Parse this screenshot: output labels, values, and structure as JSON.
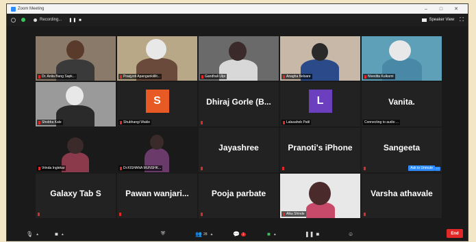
{
  "window": {
    "title": "Zoom Meeting"
  },
  "topbar": {
    "recording_label": "Recording...",
    "controls": "❚❚ ■",
    "speaker_view_label": "Speaker View"
  },
  "tiles": [
    {
      "name": "Dr. Anita Bang Sapk...",
      "type": "video",
      "muted": true
    },
    {
      "name": "Prasjyoti Apangankiillit...",
      "type": "video",
      "muted": true
    },
    {
      "name": "Gandhali Ulpi",
      "type": "video",
      "muted": true
    },
    {
      "name": "Anagha Belsare",
      "type": "video",
      "muted": true
    },
    {
      "name": "Nivedita Kulkarni",
      "type": "video",
      "muted": true,
      "active": true
    },
    {
      "name": "Shobha Kale",
      "type": "video",
      "muted": true
    },
    {
      "name": "Shubhangi Wakle",
      "type": "avatar",
      "initial": "S",
      "avatar_color": "#e85a24",
      "muted": true
    },
    {
      "name": "Dhiraj Gorle (B...",
      "type": "name",
      "muted": true
    },
    {
      "name": "Lalasaheb Patil",
      "type": "avatar",
      "initial": "L",
      "avatar_color": "#6b3fbd",
      "muted": true
    },
    {
      "name": "Vanita.",
      "type": "name",
      "status": "Connecting to audio ...",
      "muted": false
    },
    {
      "name": "Vrinda Inglekar",
      "type": "video",
      "muted": true
    },
    {
      "name": "Dr.KISHANA MUNSHK...",
      "type": "video",
      "muted": true
    },
    {
      "name": "Jayashree",
      "type": "name",
      "muted": true
    },
    {
      "name": "Pranoti's iPhone",
      "type": "name",
      "muted": true
    },
    {
      "name": "Sangeeta",
      "type": "name",
      "muted": true,
      "ask_to_unmute": "Ask to Unmute",
      "more": "···"
    },
    {
      "name": "Galaxy Tab S",
      "type": "name",
      "muted": true
    },
    {
      "name": "Pawan  wanjari...",
      "type": "name",
      "muted": true
    },
    {
      "name": "Pooja parbate",
      "type": "name",
      "muted": true
    },
    {
      "name": "Alka Shinde",
      "type": "video",
      "muted": true
    },
    {
      "name": "Varsha athavale",
      "type": "name",
      "muted": true
    }
  ],
  "toolbar": {
    "participants_count": "28",
    "chat_badge": "1",
    "end_label": "End"
  },
  "colors": {
    "accent": "#2d8cff",
    "muted_red": "#e02828",
    "active_border": "#d6d04b",
    "end_button": "#e02828"
  }
}
